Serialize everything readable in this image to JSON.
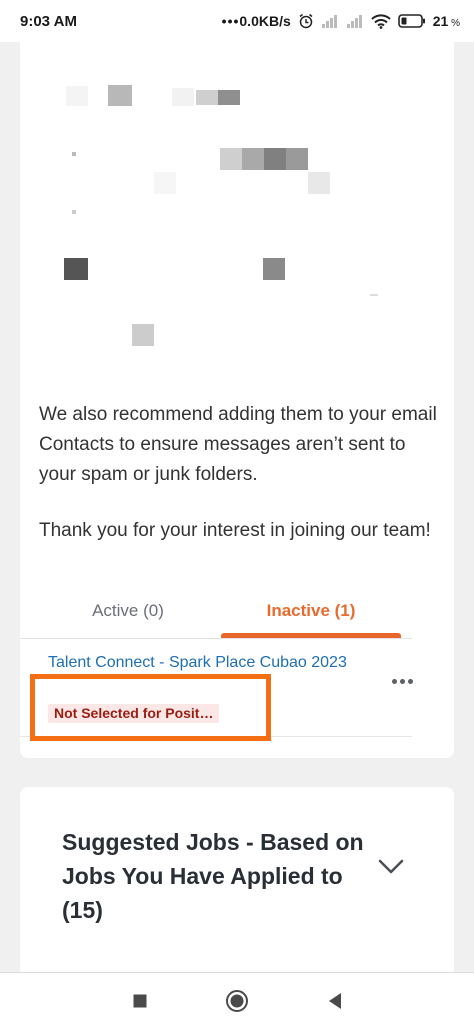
{
  "status_bar": {
    "time": "9:03 AM",
    "network_speed": "0.0KB/s",
    "battery": "21",
    "icons": [
      "alarm-icon",
      "signal-icon",
      "signal-icon",
      "wifi-icon",
      "battery-icon"
    ]
  },
  "message": {
    "paragraph_contacts": "We also recommend adding them to your email Contacts to ensure messages aren’t sent to your spam or junk folders.",
    "paragraph_thanks": "Thank you for your interest in joining our team!"
  },
  "tabs": [
    {
      "label": "Active (0)",
      "selected": false
    },
    {
      "label": "Inactive (1)",
      "selected": true
    }
  ],
  "application": {
    "title": "Talent Connect - Spark Place Cubao 2023",
    "status": "Not Selected for Posit…",
    "more_icon": "more-horizontal-icon"
  },
  "suggested_jobs": {
    "title": "Suggested Jobs - Based on Jobs You Have Applied to (15)",
    "expand_icon": "chevron-down-icon"
  },
  "nav": {
    "icons": [
      "recent-apps-icon",
      "home-icon",
      "back-icon"
    ]
  },
  "colors": {
    "accent": "#e8652b",
    "link": "#1e6fb3",
    "badge_bg": "#fbe7e5",
    "badge_text": "#9a1d12",
    "highlight": "#f46f14"
  }
}
